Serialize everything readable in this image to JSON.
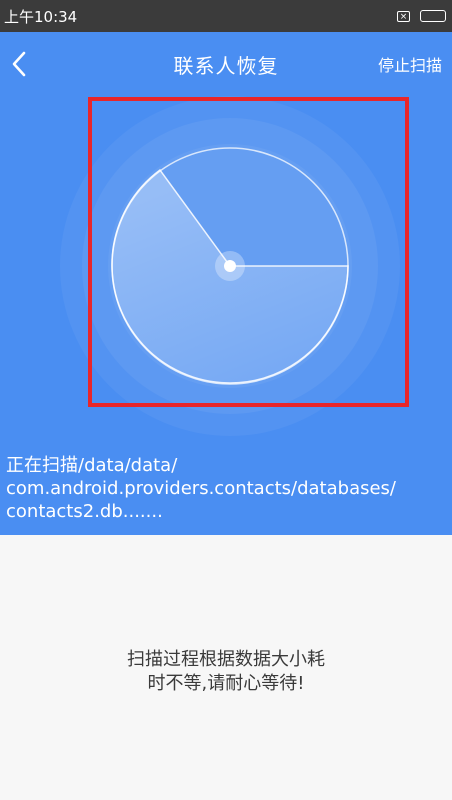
{
  "status_bar": {
    "time": "上午10:34",
    "notification_icon": "message-x-icon",
    "battery_icon": "battery-icon"
  },
  "header": {
    "back_icon": "chevron-left-icon",
    "title": "联系人恢复",
    "stop_label": "停止扫描"
  },
  "scan": {
    "radar_icon": "radar-scanner-icon",
    "path_lines": [
      "正在扫描/data/data/",
      "com.android.providers.contacts/databases/",
      "contacts2.db......."
    ]
  },
  "hint": {
    "lines": [
      "扫描过程根据数据大小耗",
      "时不等,请耐心等待!"
    ]
  },
  "colors": {
    "primary": "#4a8ef2",
    "status_bar": "#3b3b3b",
    "highlight": "#e8262a",
    "background": "#f7f7f7"
  }
}
